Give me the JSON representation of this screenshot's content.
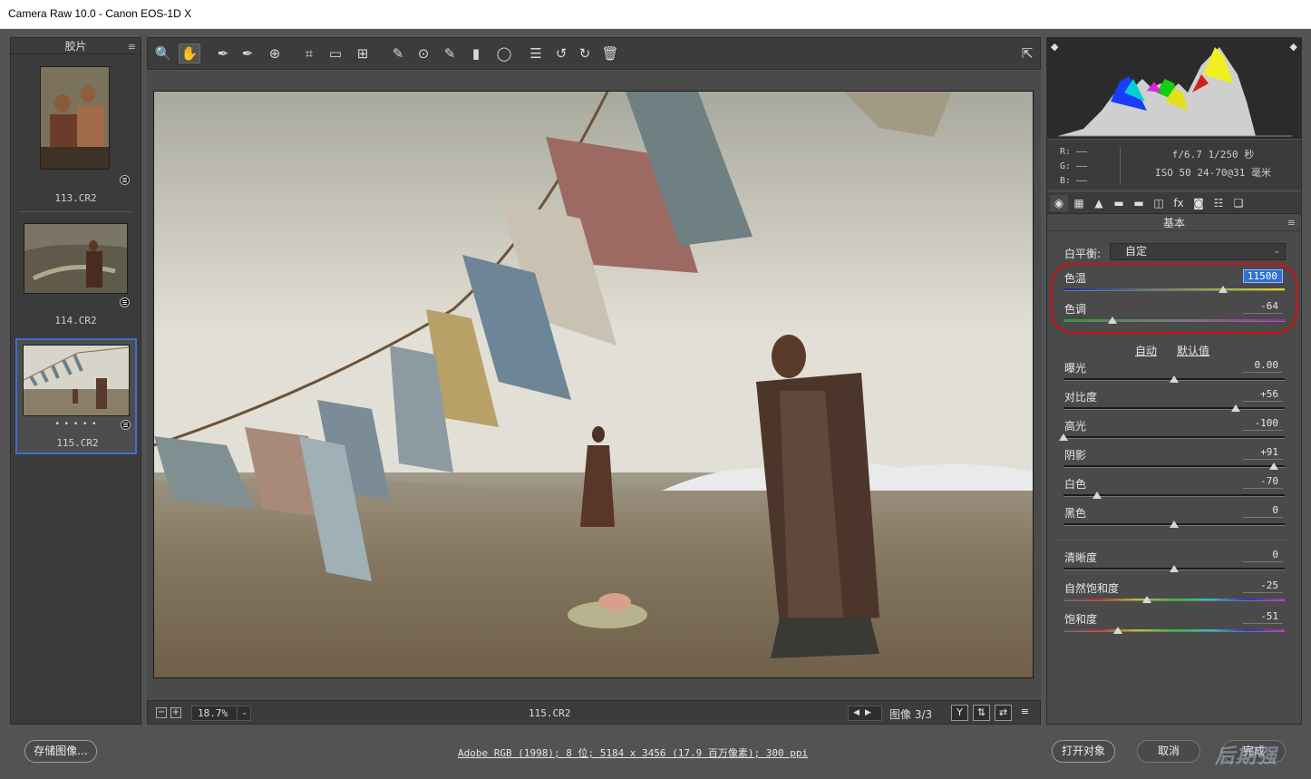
{
  "window": {
    "title": "Camera Raw 10.0 -  Canon EOS-1D X",
    "minimize": "—",
    "maximize": "☐",
    "close": "✕"
  },
  "filmstrip": {
    "header": "胶片",
    "items": [
      {
        "label": "113.CR2"
      },
      {
        "label": "114.CR2"
      },
      {
        "label": "115.CR2",
        "rating": "• • • • •",
        "selected": true
      }
    ]
  },
  "toolbar": {
    "tools": [
      "zoom-icon",
      "hand-icon",
      "white-balance-icon",
      "color-sampler-icon",
      "target-adjust-icon",
      "crop-icon",
      "straighten-icon",
      "transform-icon",
      "spot-removal-icon",
      "red-eye-icon",
      "adjustment-brush-icon",
      "graduated-filter-icon",
      "radial-filter-icon",
      "presets-list-icon",
      "rotate-left-icon",
      "rotate-right-icon",
      "delete-icon"
    ],
    "glyphs": [
      "🔍",
      "✋",
      "✒",
      "✒",
      "⊕",
      "⌗",
      "▭",
      "⊞",
      "✎",
      "⊙",
      "✎",
      "▮",
      "◯",
      "☰",
      "↺",
      "↻",
      "🗑"
    ],
    "fullscreen_glyph": "⇱"
  },
  "statusbar": {
    "zoom_out": "−",
    "zoom_in": "+",
    "zoom_value": "18.7%",
    "zoom_drop": "⌄",
    "filename": "115.CR2",
    "nav": "◀▶",
    "counter": "图像 3/3",
    "icons": [
      "Y",
      "⇅",
      "⇄",
      "≡"
    ]
  },
  "histogram": {
    "rgb_readout": [
      "R:  ——",
      "G:  ——",
      "B:  ——"
    ],
    "exif_line1": "f/6.7  1/250 秒",
    "exif_line2": "ISO 50  24-70@31 毫米"
  },
  "panel_tabs": [
    "◉",
    "▦",
    "▲",
    "▬",
    "▬",
    "◫",
    "fx",
    "◙",
    "☷",
    "❏"
  ],
  "section": {
    "title": "基本",
    "menu": "≡"
  },
  "white_balance": {
    "label": "白平衡:",
    "value": "自定",
    "arrow": "⌄"
  },
  "sliders_wb": [
    {
      "label": "色温",
      "value": "11500",
      "position": 0.72,
      "track": "temp"
    },
    {
      "label": "色调",
      "value": "-64",
      "position": 0.22,
      "track": "tint"
    }
  ],
  "auto_link": "自动",
  "default_link": "默认值",
  "sliders_tone": [
    {
      "label": "曝光",
      "value": "0.00",
      "position": 0.5
    },
    {
      "label": "对比度",
      "value": "+56",
      "position": 0.78
    },
    {
      "label": "高光",
      "value": "-100",
      "position": 0.0
    },
    {
      "label": "阴影",
      "value": "+91",
      "position": 0.95
    },
    {
      "label": "白色",
      "value": "-70",
      "position": 0.15
    },
    {
      "label": "黑色",
      "value": "0",
      "position": 0.5
    }
  ],
  "sliders_presence": [
    {
      "label": "清晰度",
      "value": "0",
      "position": 0.5,
      "track": "plain"
    },
    {
      "label": "自然饱和度",
      "value": "-25",
      "position": 0.375,
      "track": "vib"
    },
    {
      "label": "饱和度",
      "value": "-51",
      "position": 0.245,
      "track": "vib"
    }
  ],
  "bottom": {
    "save_label": "存储图像...",
    "info": "Adobe RGB (1998); 8 位; 5184 x 3456 (17.9 百万像素); 300 ppi",
    "open_label": "打开对象",
    "cancel_label": "取消",
    "done_label": "完成",
    "watermark": "后期强"
  },
  "colors": {
    "accent": "#3a6fd0",
    "highlight": "#d01010",
    "panel_bg": "#4a4a4a"
  }
}
